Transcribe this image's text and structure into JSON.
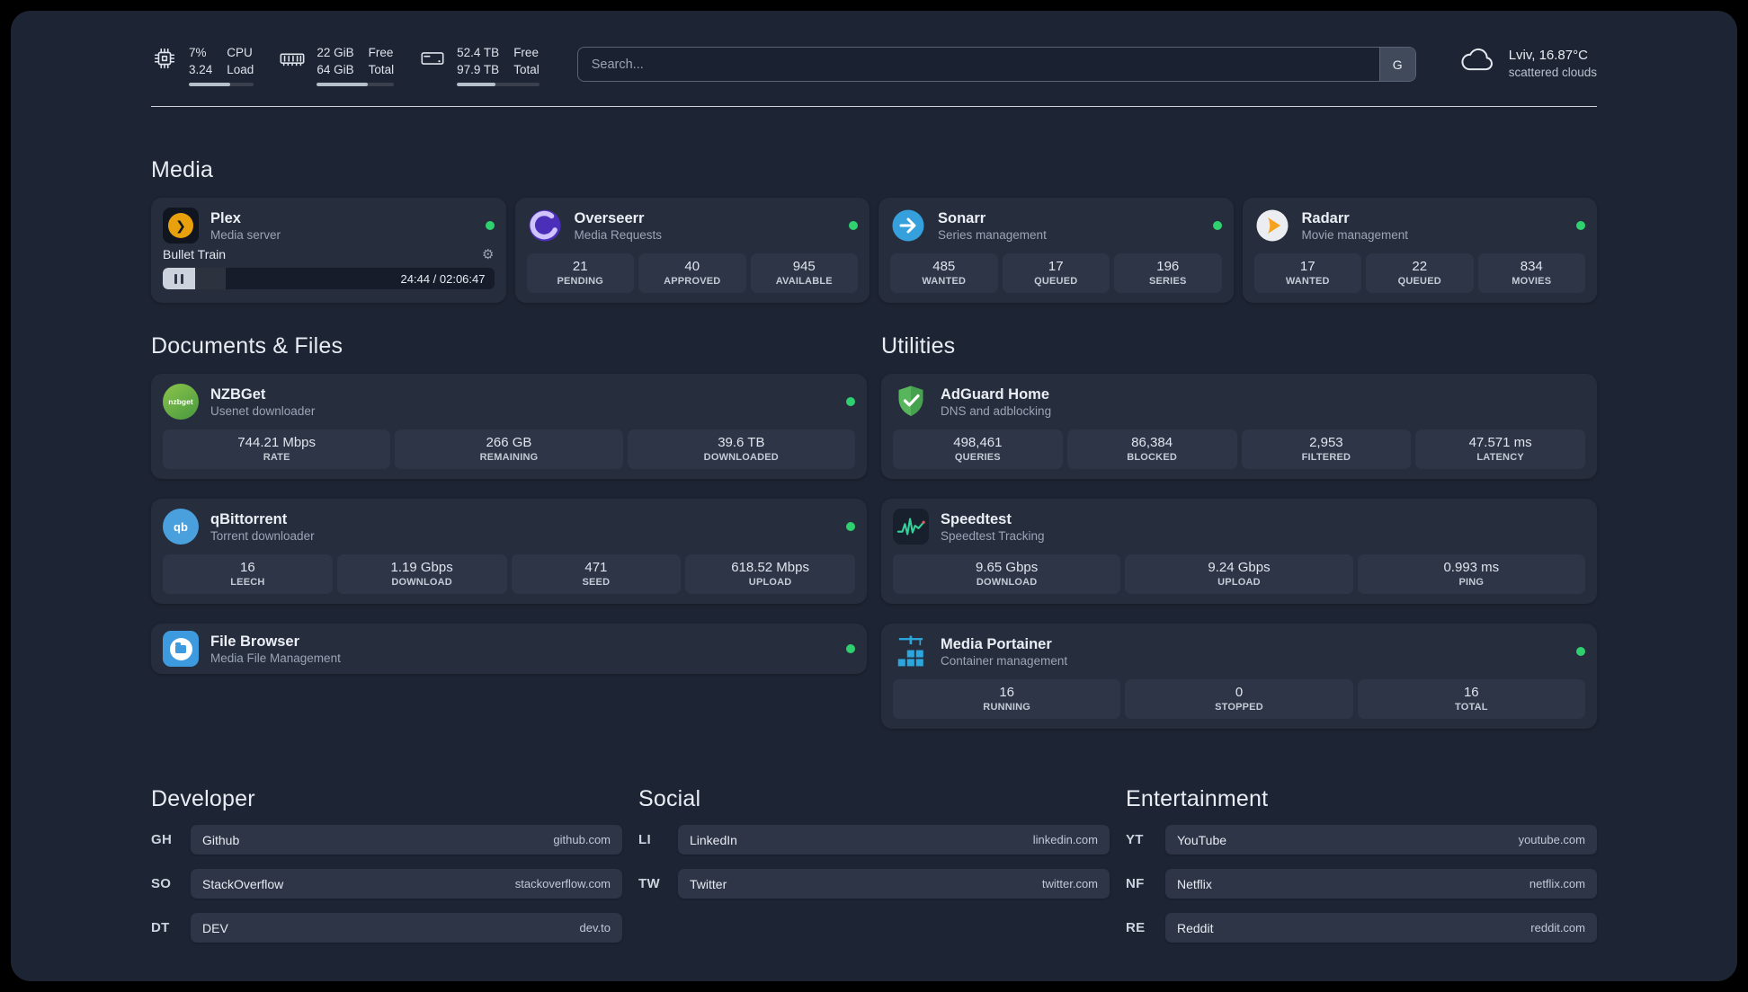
{
  "colors": {
    "status_green": "#2fd06f",
    "accent_plex_gold": "#e8a00c"
  },
  "glyphs": {
    "plex_chevron": "❯",
    "gear": "⚙"
  },
  "topbar": {
    "cpu": {
      "pct": "7%",
      "load": "3.24",
      "label_top": "CPU",
      "label_bottom": "Load",
      "bar_pct": 64
    },
    "memory": {
      "free": "22 GiB",
      "total": "64 GiB",
      "label_top": "Free",
      "label_bottom": "Total",
      "bar_pct": 66
    },
    "disk": {
      "free": "52.4 TB",
      "total": "97.9 TB",
      "label_top": "Free",
      "label_bottom": "Total",
      "bar_pct": 47
    },
    "search": {
      "placeholder": "Search...",
      "engine_button": "G"
    },
    "weather": {
      "location": "Lviv, 16.87°C",
      "condition": "scattered clouds"
    }
  },
  "media": {
    "heading": "Media",
    "plex": {
      "name": "Plex",
      "desc": "Media server",
      "now_playing": "Bullet Train",
      "time": "24:44 / 02:06:47",
      "progress_pct": 19
    },
    "overseerr": {
      "name": "Overseerr",
      "desc": "Media Requests",
      "stats": [
        {
          "value": "21",
          "label": "PENDING"
        },
        {
          "value": "40",
          "label": "APPROVED"
        },
        {
          "value": "945",
          "label": "AVAILABLE"
        }
      ]
    },
    "sonarr": {
      "name": "Sonarr",
      "desc": "Series management",
      "stats": [
        {
          "value": "485",
          "label": "WANTED"
        },
        {
          "value": "17",
          "label": "QUEUED"
        },
        {
          "value": "196",
          "label": "SERIES"
        }
      ]
    },
    "radarr": {
      "name": "Radarr",
      "desc": "Movie management",
      "stats": [
        {
          "value": "17",
          "label": "WANTED"
        },
        {
          "value": "22",
          "label": "QUEUED"
        },
        {
          "value": "834",
          "label": "MOVIES"
        }
      ]
    }
  },
  "documents": {
    "heading": "Documents & Files",
    "nzbget": {
      "name": "NZBGet",
      "desc": "Usenet downloader",
      "icon_text": "nzbget",
      "stats": [
        {
          "value": "744.21 Mbps",
          "label": "RATE"
        },
        {
          "value": "266 GB",
          "label": "REMAINING"
        },
        {
          "value": "39.6 TB",
          "label": "DOWNLOADED"
        }
      ]
    },
    "qbittorrent": {
      "name": "qBittorrent",
      "desc": "Torrent downloader",
      "icon_text": "qb",
      "stats": [
        {
          "value": "16",
          "label": "LEECH"
        },
        {
          "value": "1.19 Gbps",
          "label": "DOWNLOAD"
        },
        {
          "value": "471",
          "label": "SEED"
        },
        {
          "value": "618.52 Mbps",
          "label": "UPLOAD"
        }
      ]
    },
    "filebrowser": {
      "name": "File Browser",
      "desc": "Media File Management"
    }
  },
  "utilities": {
    "heading": "Utilities",
    "adguard": {
      "name": "AdGuard Home",
      "desc": "DNS and adblocking",
      "stats": [
        {
          "value": "498,461",
          "label": "QUERIES"
        },
        {
          "value": "86,384",
          "label": "BLOCKED"
        },
        {
          "value": "2,953",
          "label": "FILTERED"
        },
        {
          "value": "47.571 ms",
          "label": "LATENCY"
        }
      ]
    },
    "speedtest": {
      "name": "Speedtest",
      "desc": "Speedtest Tracking",
      "stats": [
        {
          "value": "9.65 Gbps",
          "label": "DOWNLOAD"
        },
        {
          "value": "9.24 Gbps",
          "label": "UPLOAD"
        },
        {
          "value": "0.993 ms",
          "label": "PING"
        }
      ]
    },
    "portainer": {
      "name": "Media Portainer",
      "desc": "Container management",
      "stats": [
        {
          "value": "16",
          "label": "RUNNING"
        },
        {
          "value": "0",
          "label": "STOPPED"
        },
        {
          "value": "16",
          "label": "TOTAL"
        }
      ]
    }
  },
  "bookmarks": {
    "developer": {
      "heading": "Developer",
      "items": [
        {
          "abbr": "GH",
          "name": "Github",
          "domain": "github.com"
        },
        {
          "abbr": "SO",
          "name": "StackOverflow",
          "domain": "stackoverflow.com"
        },
        {
          "abbr": "DT",
          "name": "DEV",
          "domain": "dev.to"
        }
      ]
    },
    "social": {
      "heading": "Social",
      "items": [
        {
          "abbr": "LI",
          "name": "LinkedIn",
          "domain": "linkedin.com"
        },
        {
          "abbr": "TW",
          "name": "Twitter",
          "domain": "twitter.com"
        }
      ]
    },
    "entertainment": {
      "heading": "Entertainment",
      "items": [
        {
          "abbr": "YT",
          "name": "YouTube",
          "domain": "youtube.com"
        },
        {
          "abbr": "NF",
          "name": "Netflix",
          "domain": "netflix.com"
        },
        {
          "abbr": "RE",
          "name": "Reddit",
          "domain": "reddit.com"
        }
      ]
    }
  }
}
